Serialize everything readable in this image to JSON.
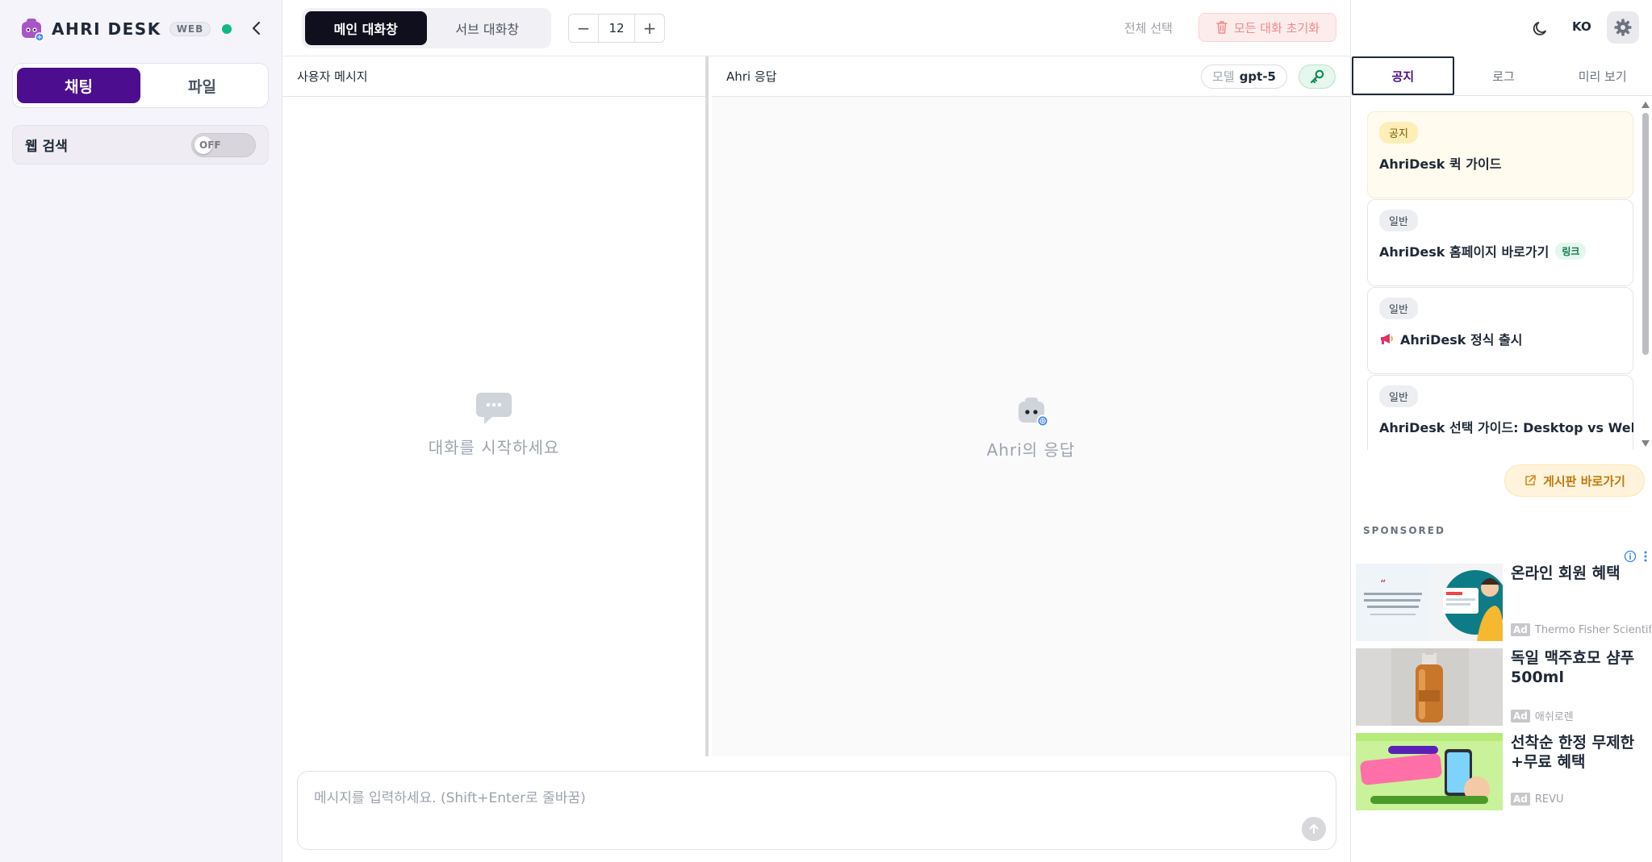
{
  "app": {
    "name": "AHRI DESK",
    "badge": "WEB",
    "status_color": "#10b981",
    "accent_color": "#4c0d8e"
  },
  "sidebar": {
    "mode_tabs": [
      {
        "label": "채팅",
        "active": true
      },
      {
        "label": "파일",
        "active": false
      }
    ],
    "web_search": {
      "label": "웹 검색",
      "toggle_text": "OFF",
      "enabled": false
    }
  },
  "toolbar": {
    "window_tabs": [
      {
        "label": "메인 대화창",
        "active": true
      },
      {
        "label": "서브 대화창",
        "active": false
      }
    ],
    "font_size_value": "12",
    "minus_label": "−",
    "plus_label": "+",
    "select_all_label": "전체 선택",
    "reset_label": "모든 대화 초기화"
  },
  "user_pane": {
    "title": "사용자 메시지",
    "empty_text": "대화를 시작하세요"
  },
  "ai_pane": {
    "title": "Ahri 응답",
    "model_label": "모델",
    "model_value": "gpt-5",
    "empty_text": "Ahri의 응답"
  },
  "composer": {
    "placeholder": "메시지를 입력하세요. (Shift+Enter로 줄바꿈)"
  },
  "right_panel": {
    "lang_label": "KO",
    "tabs": [
      {
        "label": "공지",
        "active": true
      },
      {
        "label": "로그",
        "active": false
      },
      {
        "label": "미리 보기",
        "active": false
      }
    ],
    "notices": [
      {
        "tag": "공지",
        "title": "AhriDesk 퀵 가이드",
        "pinned": true
      },
      {
        "tag": "일반",
        "title": "AhriDesk 홈페이지 바로가기",
        "chip": "링크"
      },
      {
        "tag": "일반",
        "title": "AhriDesk 정식 출시",
        "icon": "megaphone-icon"
      },
      {
        "tag": "일반",
        "title": "AhriDesk 선택 가이드: Desktop vs Web"
      }
    ],
    "board_button_label": "게시판 바로가기",
    "sponsored_label": "SPONSORED",
    "ads": [
      {
        "title": "온라인 회원 혜택",
        "ad_mark": "Ad",
        "source": "Thermo Fisher Scientific"
      },
      {
        "title": "독일 맥주효모 샴푸 500ml",
        "ad_mark": "Ad",
        "source": "애쉬로렌"
      },
      {
        "title": "선착순 한정 무제한+무료 혜택",
        "ad_mark": "Ad",
        "source": "REVU"
      }
    ]
  }
}
